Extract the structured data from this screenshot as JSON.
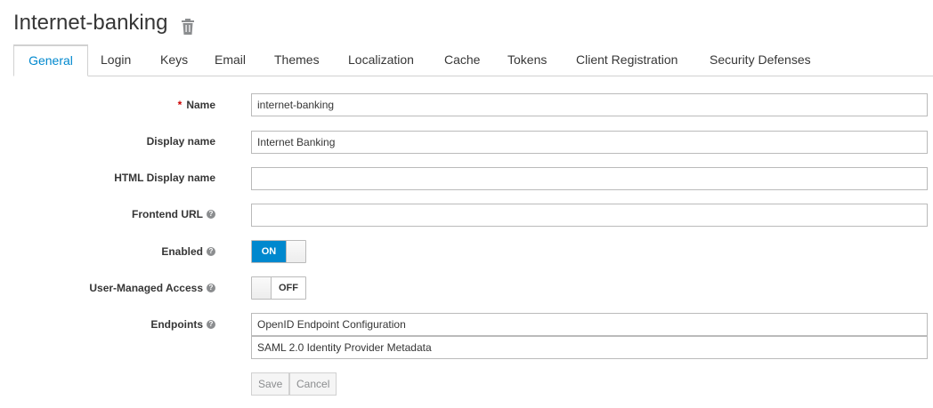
{
  "header": {
    "title": "Internet-banking",
    "delete_icon": "trash-icon"
  },
  "tabs": [
    {
      "label": "General",
      "active": true
    },
    {
      "label": "Login"
    },
    {
      "label": "Keys"
    },
    {
      "label": "Email"
    },
    {
      "label": "Themes"
    },
    {
      "label": "Localization"
    },
    {
      "label": "Cache"
    },
    {
      "label": "Tokens"
    },
    {
      "label": "Client Registration"
    },
    {
      "label": "Security Defenses"
    }
  ],
  "form": {
    "name": {
      "label": "Name",
      "required_mark": "*",
      "value": "internet-banking"
    },
    "display_name": {
      "label": "Display name",
      "value": "Internet Banking"
    },
    "html_display_name": {
      "label": "HTML Display name",
      "value": ""
    },
    "frontend_url": {
      "label": "Frontend URL",
      "value": ""
    },
    "enabled": {
      "label": "Enabled",
      "state": "ON"
    },
    "user_managed_access": {
      "label": "User-Managed Access",
      "state": "OFF"
    },
    "endpoints": {
      "label": "Endpoints",
      "items": [
        "OpenID Endpoint Configuration",
        "SAML 2.0 Identity Provider Metadata"
      ]
    }
  },
  "buttons": {
    "save": "Save",
    "cancel": "Cancel"
  },
  "colors": {
    "accent": "#0088ce",
    "required": "#cc0000"
  }
}
